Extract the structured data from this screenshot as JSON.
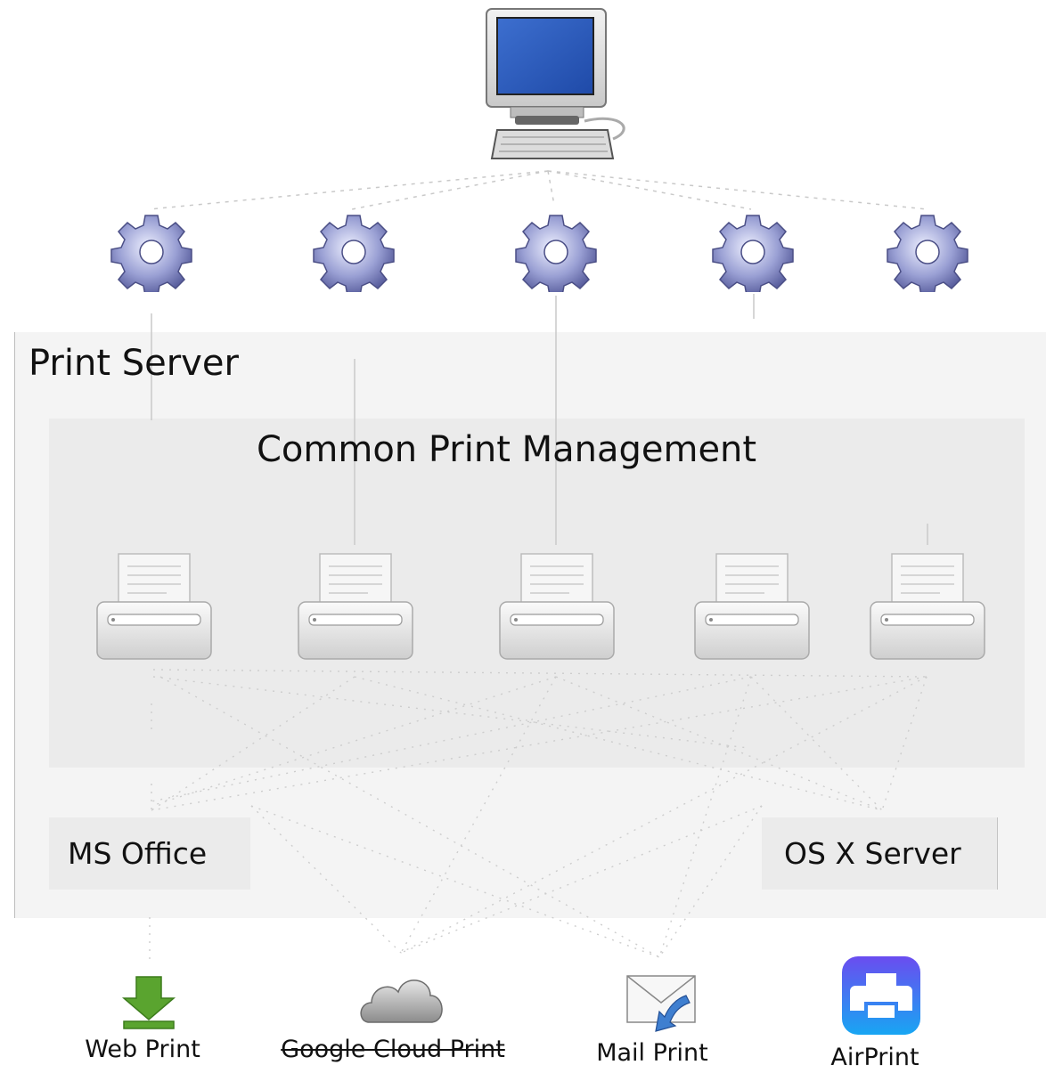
{
  "diagram": {
    "print_server_label": "Print Server",
    "management_label": "Common Print Management",
    "ms_office_label": "MS Office",
    "osx_server_label": "OS X Server",
    "outputs": [
      {
        "label": "Web Print",
        "icon": "download-arrow-icon"
      },
      {
        "label": "Google Cloud Print",
        "icon": "cloud-icon",
        "struck_through": true
      },
      {
        "label": "Mail Print",
        "icon": "mail-icon"
      },
      {
        "label": "AirPrint",
        "icon": "airprint-icon"
      }
    ],
    "top_node_icon": "computer-icon",
    "service_icon": "gear-icon",
    "printer_icon": "printer-icon",
    "colors": {
      "server_background": "#f4f4f4",
      "management_background": "#ebebeb",
      "gear": "#8a8fc4",
      "download_arrow": "#5aa42f",
      "airprint": "#1e8ef0",
      "connector": "#c7c7c7"
    }
  }
}
